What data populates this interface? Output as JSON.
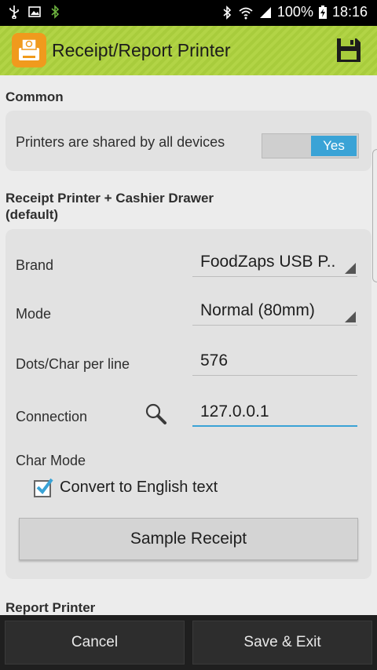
{
  "status_bar": {
    "battery": "100%",
    "time": "18:16"
  },
  "action_bar": {
    "title": "Receipt/Report Printer"
  },
  "common": {
    "section_title": "Common",
    "shared_label": "Printers are shared by all devices",
    "toggle_value": "Yes"
  },
  "receipt_printer": {
    "section_title_line1": "Receipt Printer + Cashier Drawer",
    "section_title_line2": "(default)",
    "brand_label": "Brand",
    "brand_value": "FoodZaps USB P..",
    "mode_label": "Mode",
    "mode_value": "Normal (80mm)",
    "dots_label": "Dots/Char per line",
    "dots_value": "576",
    "connection_label": "Connection",
    "connection_value": "127.0.0.1",
    "char_mode_label": "Char Mode",
    "convert_label": "Convert to English text",
    "convert_checked": true,
    "sample_button": "Sample Receipt"
  },
  "report_printer": {
    "section_title": "Report Printer"
  },
  "bottom_bar": {
    "cancel": "Cancel",
    "save_exit": "Save & Exit"
  },
  "colors": {
    "accent": "#3aa3d6",
    "action_bar": "#a8cc3c",
    "app_icon": "#f09a1d"
  }
}
